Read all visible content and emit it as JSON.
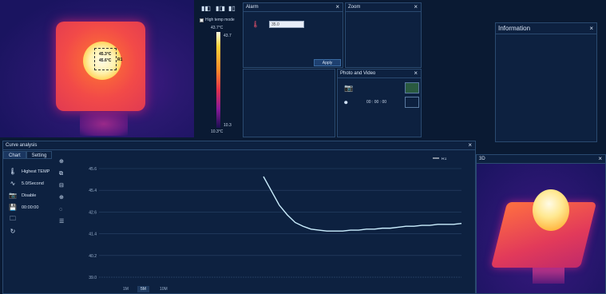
{
  "thermal": {
    "max_label": "45.3°C",
    "min_label": "45.6°C",
    "roi_label": "R1"
  },
  "toolbar": {
    "icon1": "▮◧",
    "icon2": "▮◨",
    "icon3": "▮▯",
    "high_temp_mode": "High temp mode"
  },
  "scale": {
    "top": "43.7°C",
    "top_marker": "43.7",
    "bottom_marker": "10.3",
    "bottom": "10.3°C"
  },
  "alarm": {
    "title": "Alarm",
    "value": "35.0",
    "apply": "Apply"
  },
  "zoom": {
    "title": "Zoom"
  },
  "photo": {
    "title": "Photo and Video",
    "timer": "00 : 00 : 00"
  },
  "info": {
    "title": "Information"
  },
  "view3d": {
    "title": "3D"
  },
  "curve": {
    "title": "Curve analysis",
    "tab_chart": "Chart",
    "tab_setting": "Setting",
    "items": [
      {
        "label": "Highest TEMP"
      },
      {
        "label": "5.0/Second"
      },
      {
        "label": "Disable"
      },
      {
        "label": "00:00:00"
      },
      {
        "label": ""
      },
      {
        "label": ""
      }
    ],
    "ranges": [
      "1M",
      "5M",
      "10M"
    ]
  },
  "chart_data": {
    "type": "line",
    "series": [
      {
        "name": "R1",
        "x": [
          0,
          2,
          4,
          6,
          8,
          10,
          12,
          14,
          16,
          18,
          20,
          22,
          24,
          26,
          28,
          30,
          32,
          34,
          36,
          38,
          40,
          42,
          44,
          46,
          48,
          50
        ],
        "values": [
          45.6,
          45.45,
          45.3,
          45.2,
          45.12,
          45.08,
          45.05,
          45.04,
          45.03,
          45.03,
          45.03,
          45.04,
          45.04,
          45.05,
          45.05,
          45.06,
          45.06,
          45.07,
          45.08,
          45.08,
          45.09,
          45.09,
          45.1,
          45.1,
          45.1,
          45.11
        ]
      }
    ],
    "ytick_labels": [
      "45.6",
      "45.4",
      "42.6",
      "41.4",
      "40.2",
      "39.0"
    ],
    "legend": "top-right",
    "grid": true
  },
  "colors": {
    "background": "#0a1a33",
    "panel": "#0d2140",
    "border": "#2a4a70",
    "line": "#ccefff"
  }
}
